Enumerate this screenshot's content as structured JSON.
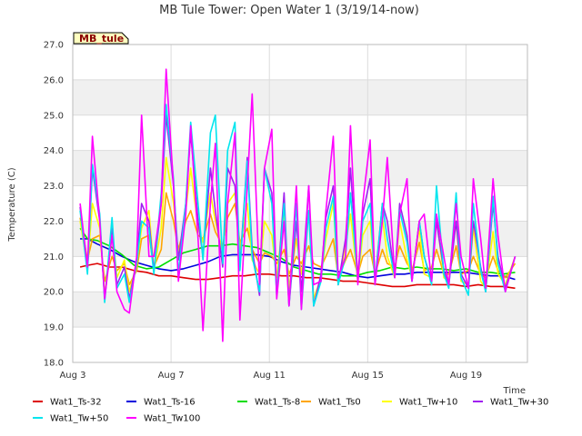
{
  "chart_data": {
    "type": "line",
    "title": "MB Tule Tower: Open Water 1 (3/19/14-now)",
    "xlabel": "Time",
    "ylabel": "Temperature (C)",
    "station_tag": "MB_tule",
    "ylim": [
      18.0,
      27.0
    ],
    "xlim_days": [
      3,
      21.5
    ],
    "x_unit": "day of August",
    "yticks": [
      "18.0",
      "19.0",
      "20.0",
      "21.0",
      "22.0",
      "23.0",
      "24.0",
      "25.0",
      "26.0",
      "27.0"
    ],
    "xticks": [
      {
        "day": 3,
        "label": "Aug 3"
      },
      {
        "day": 7,
        "label": "Aug 7"
      },
      {
        "day": 11,
        "label": "Aug 11"
      },
      {
        "day": 15,
        "label": "Aug 15"
      },
      {
        "day": 19,
        "label": "Aug 19"
      }
    ],
    "grid": true,
    "banded_background": true,
    "legend_position": "bottom",
    "series": [
      {
        "name": "Wat1_Ts-32",
        "color": "#dd0000",
        "x": [
          3.3,
          3.6,
          4.0,
          4.5,
          5.0,
          5.5,
          6.0,
          6.5,
          7.0,
          7.5,
          8.0,
          8.5,
          9.0,
          9.5,
          10.0,
          10.5,
          11.0,
          11.5,
          12.0,
          12.5,
          13.0,
          13.5,
          14.0,
          14.5,
          15.0,
          15.5,
          16.0,
          16.5,
          17.0,
          17.5,
          18.0,
          18.5,
          19.0,
          19.5,
          20.0,
          20.5,
          21.0
        ],
        "y": [
          20.7,
          20.75,
          20.8,
          20.7,
          20.7,
          20.6,
          20.55,
          20.45,
          20.45,
          20.4,
          20.35,
          20.35,
          20.4,
          20.45,
          20.45,
          20.5,
          20.5,
          20.45,
          20.45,
          20.4,
          20.4,
          20.35,
          20.3,
          20.3,
          20.25,
          20.2,
          20.15,
          20.15,
          20.2,
          20.2,
          20.2,
          20.2,
          20.15,
          20.2,
          20.15,
          20.15,
          20.1
        ]
      },
      {
        "name": "Wat1_Ts-16",
        "color": "#0000dd",
        "x": [
          3.3,
          3.6,
          4.0,
          4.5,
          5.0,
          5.5,
          6.0,
          6.5,
          7.0,
          7.5,
          8.0,
          8.5,
          9.0,
          9.5,
          10.0,
          10.5,
          11.0,
          11.5,
          12.0,
          12.5,
          13.0,
          13.5,
          14.0,
          14.5,
          15.0,
          15.5,
          16.0,
          16.5,
          17.0,
          17.5,
          18.0,
          18.5,
          19.0,
          19.5,
          20.0,
          20.5,
          21.0
        ],
        "y": [
          21.5,
          21.5,
          21.35,
          21.2,
          21.0,
          20.85,
          20.75,
          20.65,
          20.6,
          20.65,
          20.75,
          20.85,
          21.0,
          21.05,
          21.05,
          21.05,
          21.0,
          20.85,
          20.75,
          20.7,
          20.65,
          20.6,
          20.55,
          20.45,
          20.4,
          20.45,
          20.5,
          20.5,
          20.55,
          20.55,
          20.55,
          20.55,
          20.55,
          20.5,
          20.45,
          20.45,
          20.35
        ]
      },
      {
        "name": "Wat1_Ts-8",
        "color": "#00dd00",
        "x": [
          3.3,
          3.6,
          4.0,
          4.5,
          5.0,
          5.5,
          6.0,
          6.5,
          7.0,
          7.5,
          8.0,
          8.5,
          9.0,
          9.5,
          10.0,
          10.5,
          11.0,
          11.5,
          12.0,
          12.5,
          13.0,
          13.5,
          14.0,
          14.5,
          15.0,
          15.5,
          16.0,
          16.5,
          17.0,
          17.5,
          18.0,
          18.5,
          19.0,
          19.5,
          20.0,
          20.5,
          21.0
        ],
        "y": [
          21.8,
          21.5,
          21.45,
          21.3,
          21.05,
          20.75,
          20.65,
          20.7,
          20.9,
          21.1,
          21.2,
          21.3,
          21.3,
          21.35,
          21.3,
          21.25,
          21.1,
          20.95,
          20.7,
          20.6,
          20.5,
          20.5,
          20.45,
          20.45,
          20.55,
          20.6,
          20.7,
          20.65,
          20.7,
          20.65,
          20.65,
          20.6,
          20.65,
          20.55,
          20.55,
          20.5,
          20.55
        ]
      },
      {
        "name": "Wat1_Ts0",
        "color": "#ffa500",
        "x": [
          3.3,
          3.6,
          3.8,
          4.1,
          4.3,
          4.6,
          4.8,
          5.1,
          5.3,
          5.6,
          5.8,
          6.1,
          6.3,
          6.6,
          6.8,
          7.1,
          7.3,
          7.6,
          7.8,
          8.1,
          8.3,
          8.6,
          8.8,
          9.1,
          9.3,
          9.6,
          9.8,
          10.1,
          10.3,
          10.6,
          10.8,
          11.1,
          11.3,
          11.6,
          11.8,
          12.1,
          12.3,
          12.6,
          12.8,
          13.1,
          13.3,
          13.6,
          13.8,
          14.1,
          14.3,
          14.6,
          14.8,
          15.1,
          15.3,
          15.6,
          15.8,
          16.1,
          16.3,
          16.6,
          16.8,
          17.1,
          17.3,
          17.6,
          17.8,
          18.1,
          18.3,
          18.6,
          18.8,
          19.1,
          19.3,
          19.6,
          19.8,
          20.1,
          20.3,
          20.6,
          21.0
        ],
        "y": [
          22.1,
          20.9,
          21.5,
          21.6,
          20.3,
          21.0,
          20.6,
          20.8,
          20.2,
          20.6,
          21.5,
          21.6,
          20.7,
          21.2,
          22.8,
          22.0,
          21.2,
          22.0,
          22.3,
          21.6,
          21.5,
          22.2,
          21.7,
          21.3,
          22.1,
          22.5,
          21.4,
          21.8,
          21.2,
          20.8,
          21.1,
          21.0,
          20.8,
          21.2,
          20.5,
          21.0,
          20.8,
          21.3,
          20.8,
          20.7,
          21.0,
          21.5,
          20.4,
          20.9,
          21.2,
          20.5,
          21.0,
          21.2,
          20.5,
          21.2,
          20.8,
          20.7,
          21.3,
          20.8,
          20.6,
          21.4,
          20.6,
          20.7,
          21.2,
          20.5,
          20.5,
          21.3,
          20.5,
          20.6,
          21.0,
          20.5,
          20.4,
          21.0,
          20.6,
          20.4,
          20.8
        ]
      },
      {
        "name": "Wat1_Tw+10",
        "color": "#ffff00",
        "x": [
          3.3,
          3.6,
          3.8,
          4.1,
          4.3,
          4.6,
          4.8,
          5.1,
          5.3,
          5.6,
          5.8,
          6.1,
          6.3,
          6.6,
          6.8,
          7.1,
          7.3,
          7.6,
          7.8,
          8.1,
          8.3,
          8.6,
          8.8,
          9.1,
          9.3,
          9.6,
          9.8,
          10.1,
          10.3,
          10.6,
          10.8,
          11.1,
          11.3,
          11.6,
          11.8,
          12.1,
          12.3,
          12.6,
          12.8,
          13.1,
          13.3,
          13.6,
          13.8,
          14.1,
          14.3,
          14.6,
          14.8,
          15.1,
          15.3,
          15.6,
          15.8,
          16.1,
          16.3,
          16.6,
          16.8,
          17.1,
          17.3,
          17.6,
          17.8,
          18.1,
          18.3,
          18.6,
          18.8,
          19.1,
          19.3,
          19.6,
          19.8,
          20.1,
          20.3,
          20.6,
          21.0
        ],
        "y": [
          22.0,
          20.7,
          22.5,
          21.8,
          19.9,
          21.8,
          20.4,
          20.9,
          20.0,
          20.8,
          21.8,
          22.3,
          20.6,
          21.8,
          23.8,
          22.5,
          21.0,
          22.3,
          23.5,
          21.8,
          21.4,
          22.8,
          22.0,
          21.1,
          22.5,
          22.8,
          21.2,
          22.5,
          20.9,
          20.5,
          22.0,
          21.6,
          20.4,
          22.3,
          20.1,
          21.5,
          20.5,
          22.3,
          19.8,
          20.4,
          21.5,
          22.5,
          20.2,
          21.3,
          22.2,
          20.3,
          21.6,
          22.0,
          20.3,
          22.1,
          21.0,
          20.4,
          22.0,
          20.9,
          20.4,
          21.8,
          20.5,
          20.4,
          22.1,
          20.4,
          20.3,
          22.0,
          20.3,
          20.2,
          21.8,
          20.3,
          20.1,
          21.7,
          20.5,
          20.2,
          21.0
        ]
      },
      {
        "name": "Wat1_Tw+30",
        "color": "#a020f0",
        "x": [
          3.3,
          3.6,
          3.8,
          4.1,
          4.3,
          4.6,
          4.8,
          5.1,
          5.3,
          5.6,
          5.8,
          6.1,
          6.3,
          6.6,
          6.8,
          7.1,
          7.3,
          7.6,
          7.8,
          8.1,
          8.3,
          8.6,
          8.8,
          9.1,
          9.3,
          9.6,
          9.8,
          10.1,
          10.3,
          10.6,
          10.8,
          11.1,
          11.3,
          11.6,
          11.8,
          12.1,
          12.3,
          12.6,
          12.8,
          13.1,
          13.3,
          13.6,
          13.8,
          14.1,
          14.3,
          14.6,
          14.8,
          15.1,
          15.3,
          15.6,
          15.8,
          16.1,
          16.3,
          16.6,
          16.8,
          17.1,
          17.3,
          17.6,
          17.8,
          18.1,
          18.3,
          18.6,
          18.8,
          19.1,
          19.3,
          19.6,
          19.8,
          20.1,
          20.3,
          20.6,
          21.0
        ],
        "y": [
          22.4,
          20.6,
          23.5,
          22.0,
          19.8,
          21.8,
          20.2,
          20.7,
          19.8,
          20.9,
          22.5,
          22.0,
          20.6,
          22.5,
          25.0,
          23.0,
          20.9,
          22.5,
          24.5,
          22.0,
          21.0,
          23.5,
          22.3,
          20.7,
          23.5,
          23.0,
          20.7,
          23.8,
          21.2,
          19.9,
          23.5,
          22.8,
          19.9,
          22.8,
          19.6,
          22.0,
          20.0,
          23.0,
          19.6,
          20.5,
          22.1,
          23.0,
          20.2,
          21.5,
          23.5,
          20.4,
          22.2,
          23.2,
          20.3,
          22.5,
          22.0,
          20.4,
          22.5,
          21.6,
          20.3,
          22.0,
          21.0,
          20.3,
          22.0,
          20.6,
          20.2,
          22.0,
          20.5,
          20.1,
          22.0,
          20.7,
          20.0,
          22.5,
          21.0,
          20.1,
          21.0
        ]
      },
      {
        "name": "Wat1_Tw+50",
        "color": "#00e5ee",
        "x": [
          3.3,
          3.6,
          3.8,
          4.1,
          4.3,
          4.6,
          4.8,
          5.1,
          5.3,
          5.6,
          5.8,
          6.1,
          6.3,
          6.6,
          6.8,
          7.1,
          7.3,
          7.6,
          7.8,
          8.1,
          8.3,
          8.6,
          8.8,
          9.1,
          9.3,
          9.6,
          9.8,
          10.1,
          10.3,
          10.6,
          10.8,
          11.1,
          11.3,
          11.6,
          11.8,
          12.1,
          12.3,
          12.6,
          12.8,
          13.1,
          13.3,
          13.6,
          13.8,
          14.1,
          14.3,
          14.6,
          14.8,
          15.1,
          15.3,
          15.6,
          15.8,
          16.1,
          16.3,
          16.6,
          16.8,
          17.1,
          17.3,
          17.6,
          17.8,
          18.1,
          18.3,
          18.6,
          18.8,
          19.1,
          19.3,
          19.6,
          19.8,
          20.1,
          20.3,
          20.6,
          21.0
        ],
        "y": [
          22.3,
          20.5,
          23.6,
          22.2,
          19.7,
          22.1,
          20.1,
          20.5,
          19.7,
          20.8,
          22.0,
          21.8,
          20.5,
          22.8,
          25.3,
          23.2,
          20.5,
          22.5,
          24.8,
          22.5,
          20.9,
          24.5,
          25.0,
          20.8,
          24.0,
          24.8,
          20.6,
          23.7,
          21.0,
          20.0,
          23.5,
          22.5,
          19.9,
          22.5,
          19.6,
          22.5,
          19.5,
          22.3,
          19.6,
          20.3,
          21.8,
          22.7,
          20.2,
          21.0,
          22.8,
          20.3,
          22.0,
          22.5,
          20.2,
          22.5,
          21.5,
          20.4,
          22.3,
          21.4,
          20.3,
          22.0,
          21.0,
          20.2,
          23.0,
          20.5,
          20.1,
          22.8,
          20.4,
          19.9,
          22.5,
          20.6,
          20.0,
          22.7,
          20.8,
          20.0,
          21.0
        ]
      },
      {
        "name": "Wat1_Tw100",
        "color": "#ff00ff",
        "x": [
          3.3,
          3.6,
          3.8,
          4.1,
          4.3,
          4.6,
          4.8,
          5.1,
          5.3,
          5.6,
          5.8,
          6.1,
          6.3,
          6.6,
          6.8,
          7.1,
          7.3,
          7.6,
          7.8,
          8.1,
          8.3,
          8.6,
          8.8,
          9.1,
          9.3,
          9.6,
          9.8,
          10.1,
          10.3,
          10.6,
          10.8,
          11.1,
          11.3,
          11.6,
          11.8,
          12.1,
          12.3,
          12.6,
          12.8,
          13.1,
          13.3,
          13.6,
          13.8,
          14.1,
          14.3,
          14.6,
          14.8,
          15.1,
          15.3,
          15.6,
          15.8,
          16.1,
          16.3,
          16.6,
          16.8,
          17.1,
          17.3,
          17.6,
          17.8,
          18.1,
          18.3,
          18.6,
          18.8,
          19.1,
          19.3,
          19.6,
          19.8,
          20.1,
          20.3,
          20.6,
          21.0
        ],
        "y": [
          22.5,
          20.7,
          24.4,
          22.0,
          19.8,
          21.6,
          20.0,
          19.5,
          19.4,
          21.0,
          25.0,
          21.0,
          21.0,
          22.5,
          26.3,
          23.0,
          20.3,
          22.2,
          24.7,
          21.5,
          18.9,
          22.5,
          24.2,
          18.6,
          22.5,
          24.5,
          19.2,
          23.0,
          25.6,
          20.2,
          23.5,
          24.6,
          19.8,
          22.0,
          19.6,
          23.0,
          19.5,
          23.0,
          20.2,
          20.3,
          22.3,
          24.4,
          20.4,
          21.0,
          24.7,
          20.2,
          22.5,
          24.3,
          20.2,
          22.0,
          23.8,
          20.4,
          22.2,
          23.2,
          20.3,
          22.0,
          22.2,
          20.3,
          22.2,
          21.0,
          20.2,
          22.5,
          21.0,
          20.1,
          23.2,
          21.5,
          20.1,
          23.2,
          21.6,
          20.0,
          21.0
        ]
      }
    ]
  }
}
